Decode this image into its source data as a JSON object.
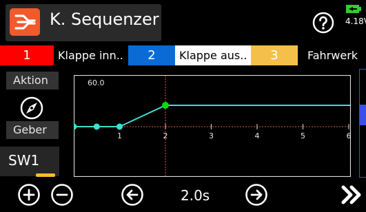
{
  "header": {
    "title": "K. Sequenzer",
    "logo_icon": "sequencer-logo-icon",
    "help_icon": "help-icon",
    "battery_icon": "battery-icon",
    "battery_voltage": "4.18V",
    "colors": {
      "logo": "#f15a2b",
      "battery": "#32cd32"
    }
  },
  "channels": [
    {
      "number": "1",
      "label": "Klappe inn..",
      "color": "#ff0000",
      "selected": false
    },
    {
      "number": "2",
      "label": "Klappe aus..",
      "color": "#0a6bd6",
      "selected": true
    },
    {
      "number": "3",
      "label": "Fahrwerk",
      "color": "#f5c04a",
      "selected": false
    }
  ],
  "left_panel": {
    "action_label": "Aktion",
    "action_icon": "compass-icon",
    "source_label": "Geber",
    "source_value": "SW1"
  },
  "graph": {
    "y_value_label": "60.0",
    "x_ticks": [
      "1",
      "2",
      "3",
      "4",
      "5",
      "6"
    ],
    "points": [
      {
        "x": 0,
        "y": 0
      },
      {
        "x": 0.5,
        "y": 0
      },
      {
        "x": 1,
        "y": 0
      },
      {
        "x": 2,
        "y": 60
      }
    ],
    "selected_point_index": 3,
    "line_color": "#40e0d0",
    "selected_color": "#00e000",
    "baseline_color": "#e65c3c"
  },
  "footer": {
    "add_icon": "plus-circle-icon",
    "remove_icon": "minus-circle-icon",
    "prev_icon": "arrow-left-circle-icon",
    "time_value": "2.0s",
    "next_icon": "arrow-right-circle-icon",
    "more_icon": "double-chevron-right-icon"
  }
}
